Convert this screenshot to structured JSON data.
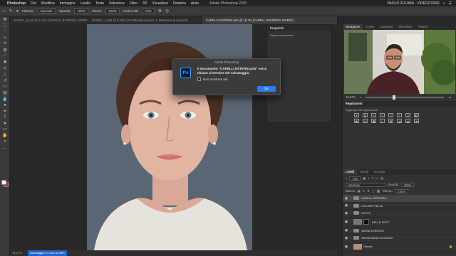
{
  "menubar": {
    "items": [
      "Photoshop",
      "File",
      "Modifica",
      "Immagine",
      "Livello",
      "Testo",
      "Selezione",
      "Filtro",
      "3D",
      "Visualizza",
      "Finestra",
      "Aiuto"
    ],
    "window_title": "Adobe Photoshop 2020",
    "user": "PAOLO ZULIANI - VIDEOCORSI"
  },
  "options": {
    "metodo_label": "Metodo:",
    "metodo_value": "Normale",
    "opacita_label": "Opacità:",
    "opacita_value": "100%",
    "flusso_label": "Flusso:",
    "flusso_value": "100%",
    "uniformita_label": "Uniformità:",
    "uniformita_value": "10%"
  },
  "tabs": [
    "MODEL_2.psd @ 17,5% (CAPELLI ESTERNI, RGB/8*) *",
    "MODEL_2.psd @ 6,53% (Tonalità/saturazione 1, Maschera di livello/8)",
    "CAPELLI ESTERNI.psb @ 16,7% (CAPELLI ESTERNI, RGB/8*)"
  ],
  "properties": {
    "title": "Proprietà",
    "subtitle": "Nessuna proprietà"
  },
  "statusbar": {
    "zoom": "16,67%",
    "progress": "Salvataggio in corso al 98%"
  },
  "dialog": {
    "title": "Adobe Photoshop",
    "message": "Il documento \"CAPELLI ESTERNI.psb\" verrà chiuso al termine del salvataggio.",
    "checkbox_label": "Non mostrare più",
    "ok_label": "OK"
  },
  "right_panels": {
    "nav_tabs": [
      "Navigatore",
      "Colore",
      "Campioni",
      "Sfumature",
      "Pattern"
    ],
    "nav_zoom": "16,67%",
    "nav_zoom_fraction": 0.34,
    "adjust_title": "Regolazioni",
    "adjust_label": "Aggiungi una regolazione",
    "layer_tabs": [
      "Livelli",
      "Canali",
      "Tracciati"
    ],
    "filter_label": "Tipo",
    "blend_value": "Normale",
    "opacita_label": "Opacità:",
    "opacita_value": "100%",
    "blocca_label": "Blocca:",
    "riemp_label": "Riemp.:",
    "riemp_value": "100%",
    "layers": [
      {
        "name": "CAPELLI ESTERNI",
        "type": "folder"
      },
      {
        "name": "COLORE PELLE",
        "type": "folder"
      },
      {
        "name": "OCCHI",
        "type": "folder"
      },
      {
        "name": "PELLE SOFT",
        "type": "masked"
      },
      {
        "name": "SEGNI EVIDENTI",
        "type": "folder"
      },
      {
        "name": "SEGNI MENO EVIDENTI",
        "type": "folder"
      },
      {
        "name": "Sfondo",
        "type": "image"
      }
    ]
  }
}
